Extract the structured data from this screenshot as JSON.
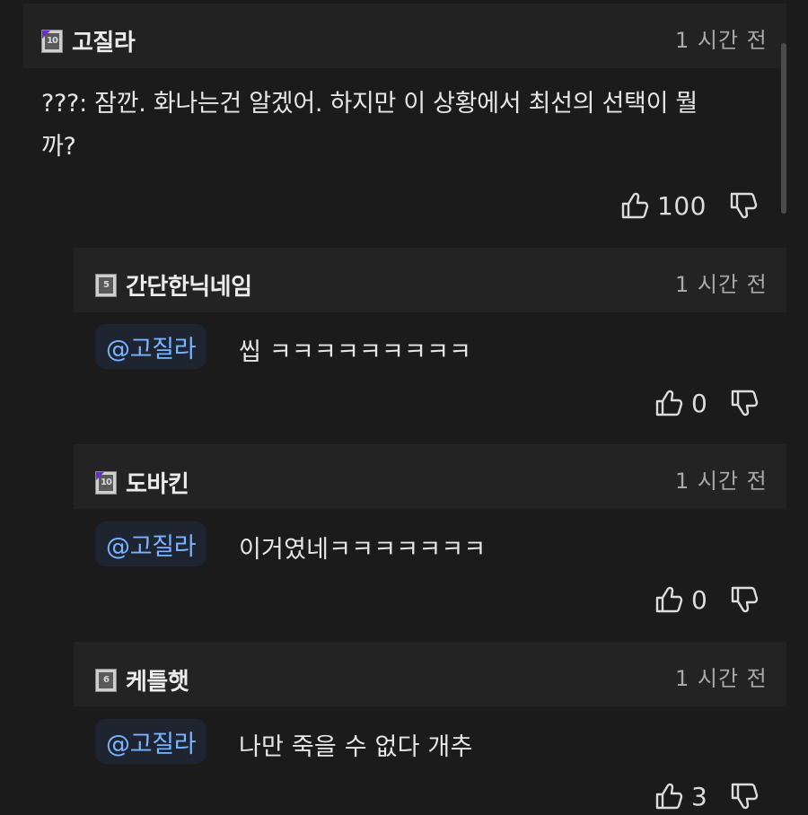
{
  "main_comment": {
    "badge_level": "10",
    "author": "고질라",
    "time": "1 시간 전",
    "body_line1": "???: 잠깐. 화나는건 알겠어. 하지만 이 상황에서 최선의 선택이 뭘",
    "body_line2": "까?",
    "likes": "100"
  },
  "replies": [
    {
      "badge_level": "5",
      "author": "간단한닉네임",
      "time": "1 시간 전",
      "mention": "@고질라",
      "text": "씹 ㅋㅋㅋㅋㅋㅋㅋㅋㅋ",
      "likes": "0"
    },
    {
      "badge_level": "10",
      "author": "도바킨",
      "time": "1 시간 전",
      "mention": "@고질라",
      "text": "이거였네ㅋㅋㅋㅋㅋㅋㅋ",
      "likes": "0"
    },
    {
      "badge_level": "6",
      "author": "케틀햇",
      "time": "1 시간 전",
      "mention": "@고질라",
      "text": "나만 죽을 수 없다 개추",
      "likes": "3"
    }
  ],
  "icons": {
    "like": "thumbs-up-icon",
    "dislike": "thumbs-down-icon"
  },
  "colors": {
    "background": "#1b1b1b",
    "mention_text": "#78b4ff",
    "badge_corner_purple": "#6a2bd8"
  }
}
